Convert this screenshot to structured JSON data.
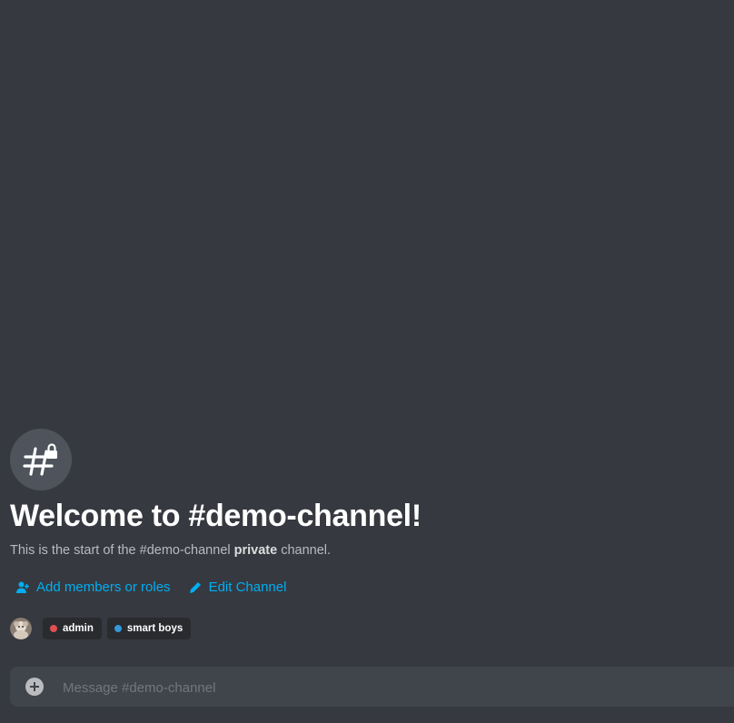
{
  "welcome": {
    "title": "Welcome to #demo-channel!",
    "subtitle_prefix": "This is the start of the #demo-channel ",
    "subtitle_emphasis": "private",
    "subtitle_suffix": " channel."
  },
  "actions": {
    "add_members_label": "Add members or roles",
    "edit_channel_label": "Edit Channel"
  },
  "roles": [
    {
      "name": "admin",
      "color": "#e05050"
    },
    {
      "name": "smart boys",
      "color": "#3498db"
    }
  ],
  "composer": {
    "placeholder": "Message #demo-channel"
  },
  "colors": {
    "background": "#36393f",
    "link": "#00aff4",
    "composer_bg": "#40444b"
  },
  "icons": {
    "channel": "locked-hash-icon",
    "add_members": "add-person-icon",
    "edit": "pencil-icon",
    "attach": "plus-circle-icon"
  }
}
